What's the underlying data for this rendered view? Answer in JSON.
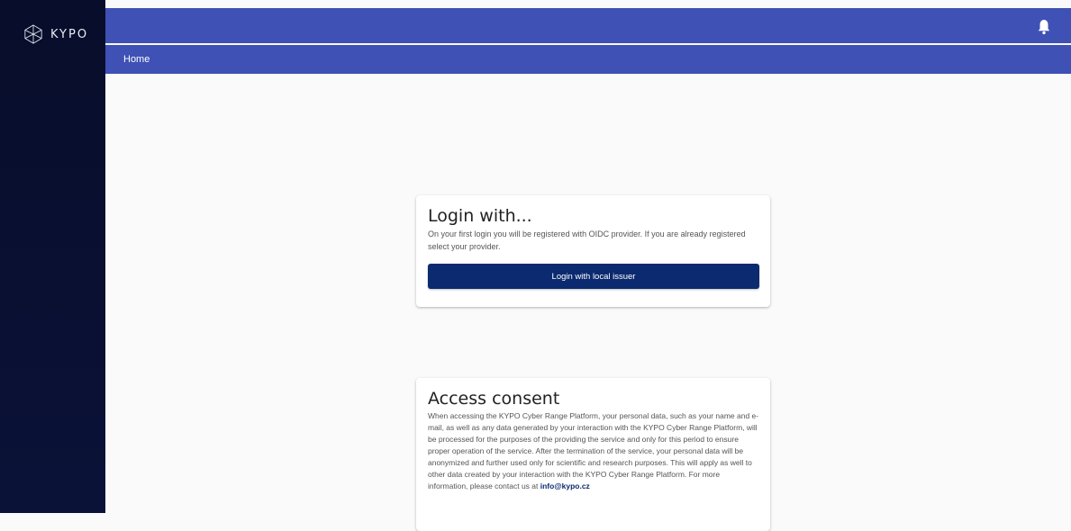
{
  "brand": {
    "name": "KYPO",
    "logo_icon": "kypo-logo-icon"
  },
  "header": {
    "bell_icon": "bell-icon"
  },
  "breadcrumb": {
    "home": "Home"
  },
  "login_card": {
    "title": "Login with...",
    "description": "On your first login you will be registered with OIDC provider. If you are already registered select your provider.",
    "button_label": "Login with local issuer"
  },
  "consent_card": {
    "title": "Access consent",
    "body": "When accessing the KYPO Cyber Range Platform, your personal data, such as your name and e-mail, as well as any data generated by your interaction with the KYPO Cyber Range Platform, will be processed for the purposes of the providing the service and only for this period to ensure proper operation of the service. After the termination of the service, your personal data will be anonymized and further used only for scientific and research purposes. This will apply as well to other data created by your interaction with the KYPO Cyber Range Platform. For more information, please contact us at ",
    "link_text": "info@kypo.cz"
  },
  "colors": {
    "sidebar": "#070d2a",
    "header": "#3f51b5",
    "primary_button": "#0b2a6f",
    "background": "#fafafa"
  }
}
